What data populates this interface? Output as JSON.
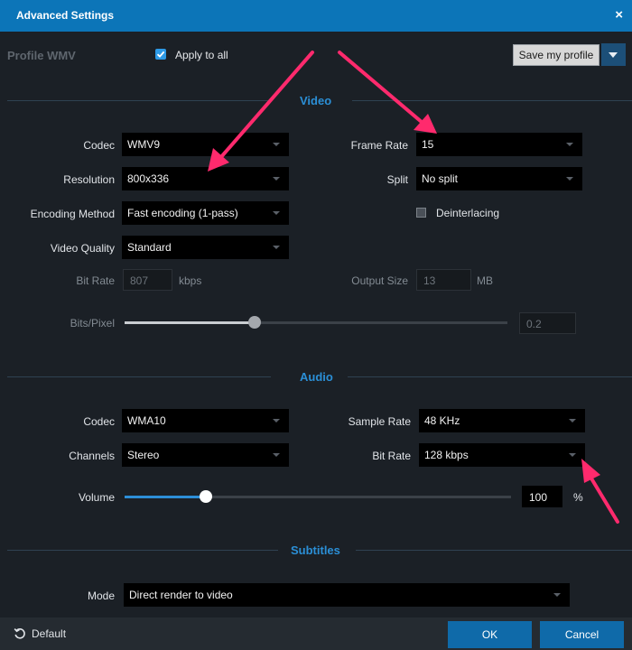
{
  "window": {
    "title": "Advanced Settings",
    "close": "×"
  },
  "profile": {
    "label": "Profile  WMV"
  },
  "apply_all": {
    "label": "Apply to all",
    "checked": true
  },
  "save_profile": {
    "label": "Save my profile"
  },
  "sections": {
    "video": "Video",
    "audio": "Audio",
    "subtitles": "Subtitles"
  },
  "video": {
    "codec": {
      "label": "Codec",
      "value": "WMV9"
    },
    "frame_rate": {
      "label": "Frame Rate",
      "value": "15"
    },
    "resolution": {
      "label": "Resolution",
      "value": "800x336"
    },
    "split": {
      "label": "Split",
      "value": "No split"
    },
    "encoding_method": {
      "label": "Encoding Method",
      "value": "Fast encoding (1-pass)"
    },
    "deinterlacing": {
      "label": "Deinterlacing",
      "checked": false
    },
    "video_quality": {
      "label": "Video Quality",
      "value": "Standard"
    },
    "bit_rate": {
      "label": "Bit Rate",
      "value": "807",
      "unit": "kbps"
    },
    "output_size": {
      "label": "Output Size",
      "value": "13",
      "unit": "MB"
    },
    "bits_pixel": {
      "label": "Bits/Pixel",
      "value": "0.2",
      "slider_fraction": 0.34
    }
  },
  "audio": {
    "codec": {
      "label": "Codec",
      "value": "WMA10"
    },
    "sample_rate": {
      "label": "Sample Rate",
      "value": "48 KHz"
    },
    "channels": {
      "label": "Channels",
      "value": "Stereo"
    },
    "bit_rate": {
      "label": "Bit Rate",
      "value": "128 kbps"
    },
    "volume": {
      "label": "Volume",
      "value": "100",
      "unit": "%",
      "slider_fraction": 0.21
    }
  },
  "subtitles": {
    "mode": {
      "label": "Mode",
      "value": "Direct render to video"
    }
  },
  "footer": {
    "default_label": "Default",
    "ok_label": "OK",
    "cancel_label": "Cancel"
  },
  "colors": {
    "accent": "#0c75b8",
    "section_title": "#2b8fd6",
    "annotation_arrow": "#ff2a6d"
  }
}
